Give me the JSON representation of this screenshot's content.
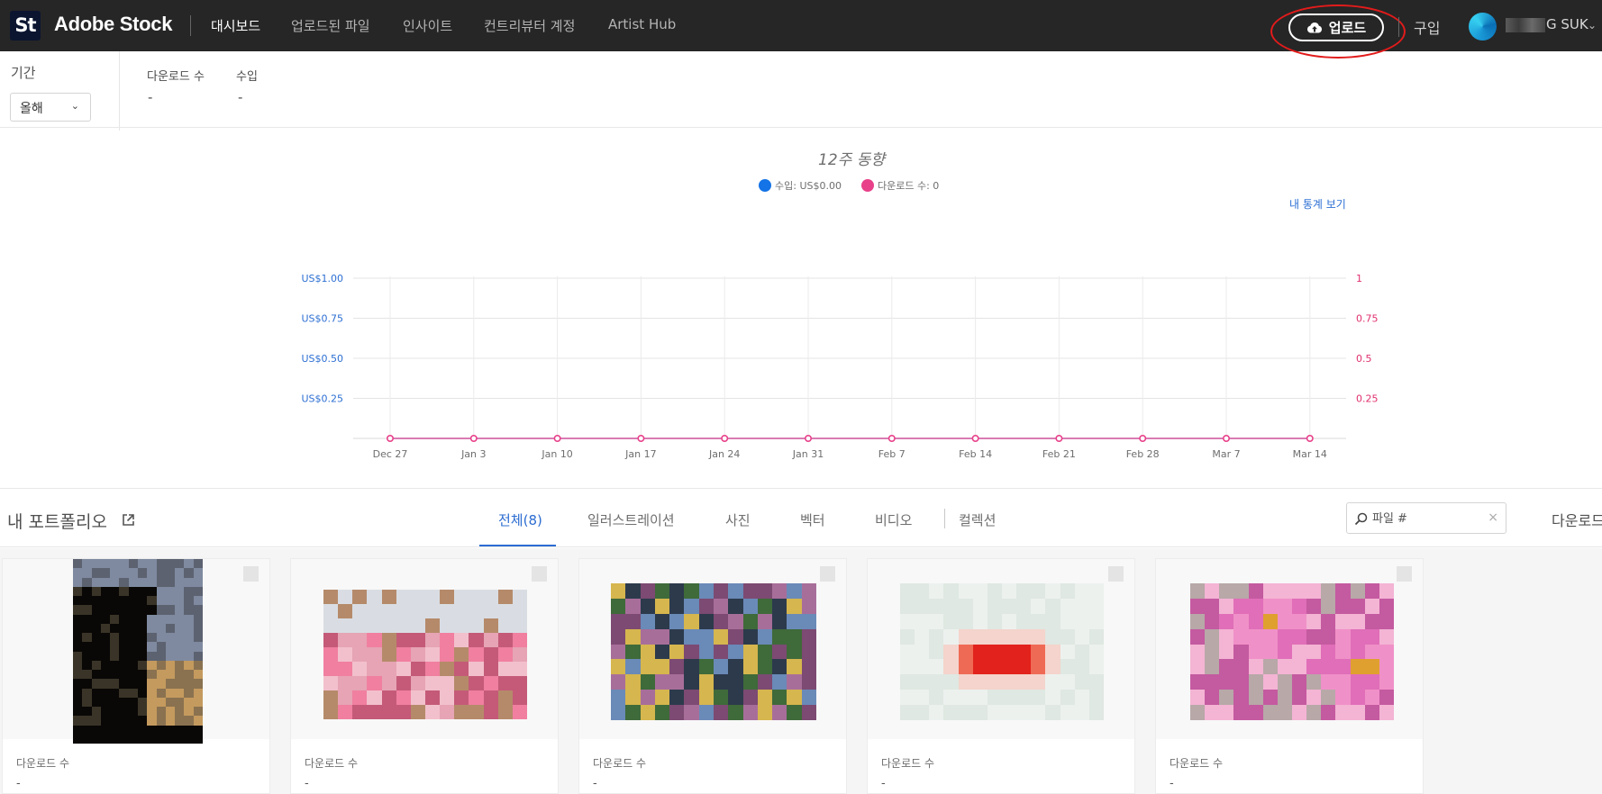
{
  "header": {
    "logo": "St",
    "brand": "Adobe Stock",
    "nav": [
      {
        "label": "대시보드",
        "active": true
      },
      {
        "label": "업로드된 파일",
        "active": false
      },
      {
        "label": "인사이트",
        "active": false
      },
      {
        "label": "컨트리뷰터 계정",
        "active": false
      },
      {
        "label": "Artist Hub",
        "active": false
      }
    ],
    "upload_label": "업로드",
    "buy_label": "구입",
    "user_name": "G SUK"
  },
  "stats": {
    "period_label": "기간",
    "period_value": "올해",
    "downloads_label": "다운로드 수",
    "downloads_value": "-",
    "revenue_label": "수입",
    "revenue_value": "-"
  },
  "chart_data": {
    "type": "line",
    "title": "12주 동향",
    "x": [
      "Dec 27",
      "Jan 3",
      "Jan 10",
      "Jan 17",
      "Jan 24",
      "Jan 31",
      "Feb 7",
      "Feb 14",
      "Feb 21",
      "Feb 28",
      "Mar 7",
      "Mar 14"
    ],
    "series": [
      {
        "name": "수입",
        "legend": "수입: US$0.00",
        "axis": "left",
        "color": "#1473e6",
        "values": [
          0,
          0,
          0,
          0,
          0,
          0,
          0,
          0,
          0,
          0,
          0,
          0
        ]
      },
      {
        "name": "다운로드 수",
        "legend": "다운로드 수: 0",
        "axis": "right",
        "color": "#e8418a",
        "values": [
          0,
          0,
          0,
          0,
          0,
          0,
          0,
          0,
          0,
          0,
          0,
          0
        ]
      }
    ],
    "y_left_ticks": [
      "US$1.00",
      "US$0.75",
      "US$0.50",
      "US$0.25"
    ],
    "y_right_ticks": [
      "1",
      "0.75",
      "0.5",
      "0.25"
    ],
    "ylim": [
      0,
      1
    ],
    "grid": true,
    "legend_position": "top-center"
  },
  "stats_link": "내 통계 보기",
  "portfolio": {
    "title": "내 포트폴리오",
    "tabs": [
      {
        "label": "전체(8)",
        "active": true
      },
      {
        "label": "일러스트레이션",
        "active": false
      },
      {
        "label": "사진",
        "active": false
      },
      {
        "label": "벡터",
        "active": false
      },
      {
        "label": "비디오",
        "active": false
      },
      {
        "label": "컬렉션",
        "active": false
      }
    ],
    "search_placeholder": "파일 #",
    "sort_label": "다운로드"
  },
  "cards": [
    {
      "downloads_label": "다운로드 수",
      "downloads_value": "-",
      "thumb": "silhouette-dusk",
      "colors": [
        "#0a0806",
        "#3a3428",
        "#8a7250",
        "#c49a5e",
        "#5c6270",
        "#7f8aa0"
      ]
    },
    {
      "downloads_label": "다운로드 수",
      "downloads_value": "-",
      "thumb": "pink-tulip-field",
      "colors": [
        "#d9dde3",
        "#e6a4b4",
        "#f07fa0",
        "#c45a78",
        "#b58a6a",
        "#f2c0cc"
      ]
    },
    {
      "downloads_label": "다운로드 수",
      "downloads_value": "-",
      "thumb": "flower-field",
      "colors": [
        "#2c3a4c",
        "#7c4a72",
        "#a86e9a",
        "#3f6a3a",
        "#d6b64e",
        "#6a8ab8"
      ]
    },
    {
      "downloads_label": "다운로드 수",
      "downloads_value": "-",
      "thumb": "red-flower",
      "colors": [
        "#ecf1ee",
        "#f4d4cc",
        "#ef6a55",
        "#e2221c",
        "#fbe6c8",
        "#dfe8e2"
      ]
    },
    {
      "downloads_label": "다운로드 수",
      "downloads_value": "-",
      "thumb": "pink-cosmos",
      "colors": [
        "#c45aa0",
        "#e06eb8",
        "#f090c8",
        "#b8a8a8",
        "#e0a030",
        "#f4b4d4"
      ]
    }
  ]
}
